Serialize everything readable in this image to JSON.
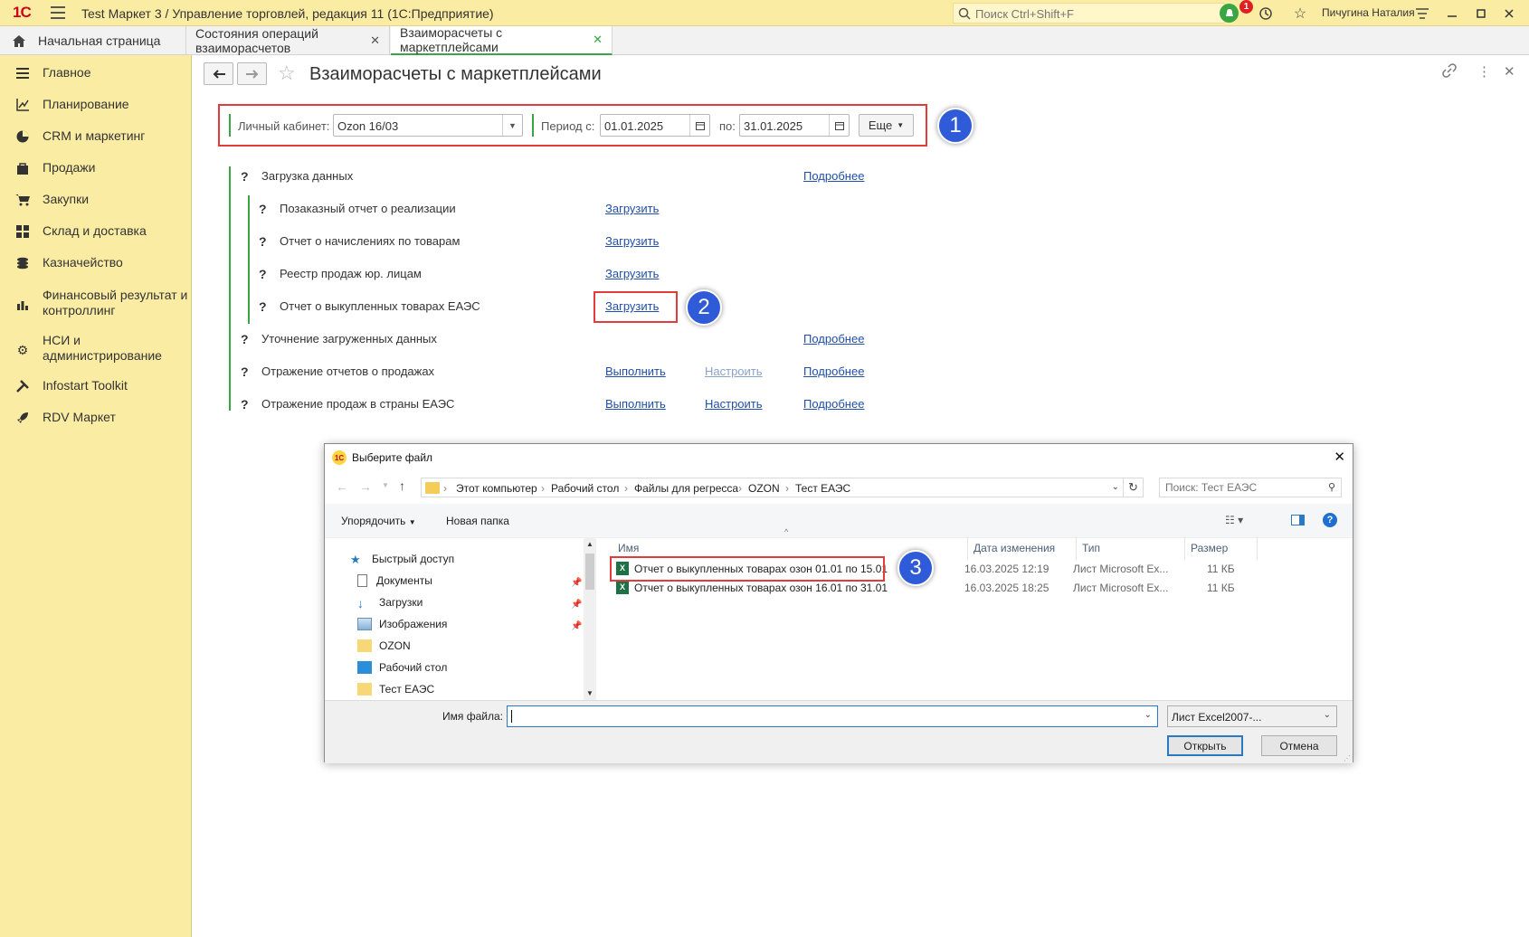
{
  "app": {
    "logo": "1С",
    "title": "Test Маркет 3 / Управление торговлей, редакция 11  (1С:Предприятие)",
    "search_placeholder": "Поиск Ctrl+Shift+F",
    "notif_count": "1",
    "user": "Пичугина Наталия"
  },
  "tabs": [
    {
      "label": "Начальная страница"
    },
    {
      "label": "Состояния операций взаиморасчетов",
      "close": "✕"
    },
    {
      "label": "Взаиморасчеты с маркетплейсами",
      "close": "✕"
    }
  ],
  "sidebar": {
    "items": [
      {
        "label": "Главное",
        "icon": "menu-icon"
      },
      {
        "label": "Планирование",
        "icon": "chart-icon"
      },
      {
        "label": "CRM и маркетинг",
        "icon": "pie-icon"
      },
      {
        "label": "Продажи",
        "icon": "bag-icon"
      },
      {
        "label": "Закупки",
        "icon": "cart-icon"
      },
      {
        "label": "Склад и доставка",
        "icon": "grid-icon"
      },
      {
        "label": "Казначейство",
        "icon": "coins-icon"
      },
      {
        "label": "Финансовый результат и",
        "label2": "контроллинг",
        "icon": "bar-icon"
      },
      {
        "label": "НСИ и",
        "label2": "администрирование",
        "icon": "gear-icon"
      },
      {
        "label": "Infostart Toolkit",
        "icon": "tools-icon"
      },
      {
        "label": "RDV Маркет",
        "icon": "rocket-icon"
      }
    ]
  },
  "form": {
    "title": "Взаиморасчеты с маркетплейсами",
    "cabinet_label": "Личный кабинет:",
    "cabinet_value": "Ozon 16/03",
    "period_label": "Период с:",
    "date_from": "01.01.2025",
    "to_label": "по:",
    "date_to": "31.01.2025",
    "more_button": "Еще",
    "q": "?",
    "steps": [
      {
        "label": "Загрузка данных",
        "more": "Подробнее"
      },
      {
        "label": "Позаказный отчет о реализации",
        "action": "Загрузить"
      },
      {
        "label": "Отчет о начислениях по товарам",
        "action": "Загрузить"
      },
      {
        "label": "Реестр продаж юр. лицам",
        "action": "Загрузить"
      },
      {
        "label": "Отчет о выкупленных товарах ЕАЭС",
        "action": "Загрузить"
      },
      {
        "label": "Уточнение загруженных данных",
        "more": "Подробнее"
      },
      {
        "label": "Отражение отчетов о продажах",
        "action": "Выполнить",
        "setup": "Настроить",
        "more": "Подробнее"
      },
      {
        "label": "Отражение продаж в страны ЕАЭС",
        "action": "Выполнить",
        "setup": "Настроить",
        "more": "Подробнее"
      }
    ]
  },
  "callouts": [
    "1",
    "2",
    "3"
  ],
  "dialog": {
    "title": "Выберите файл",
    "path": [
      "Этот компьютер",
      "Рабочий стол",
      "Файлы для регресса",
      "OZON",
      "Тест ЕАЭС"
    ],
    "search_placeholder": "Поиск: Тест ЕАЭС",
    "organize": "Упорядочить",
    "new_folder": "Новая папка",
    "nav": [
      {
        "label": "Быстрый доступ"
      },
      {
        "label": "Документы"
      },
      {
        "label": "Загрузки"
      },
      {
        "label": "Изображения"
      },
      {
        "label": "OZON"
      },
      {
        "label": "Рабочий стол"
      },
      {
        "label": "Тест ЕАЭС"
      }
    ],
    "columns": [
      "Имя",
      "Дата изменения",
      "Тип",
      "Размер"
    ],
    "files": [
      {
        "name": "Отчет о выкупленных товарах озон 01.01 по 15.01",
        "date": "16.03.2025 12:19",
        "type": "Лист Microsoft Ex...",
        "size": "11 КБ"
      },
      {
        "name": "Отчет о выкупленных товарах озон 16.01 по 31.01",
        "date": "16.03.2025 18:25",
        "type": "Лист Microsoft Ex...",
        "size": "11 КБ"
      }
    ],
    "filename_label": "Имя файла:",
    "filename_value": "",
    "filetype": "Лист Excel2007-...",
    "open": "Открыть",
    "cancel": "Отмена"
  }
}
